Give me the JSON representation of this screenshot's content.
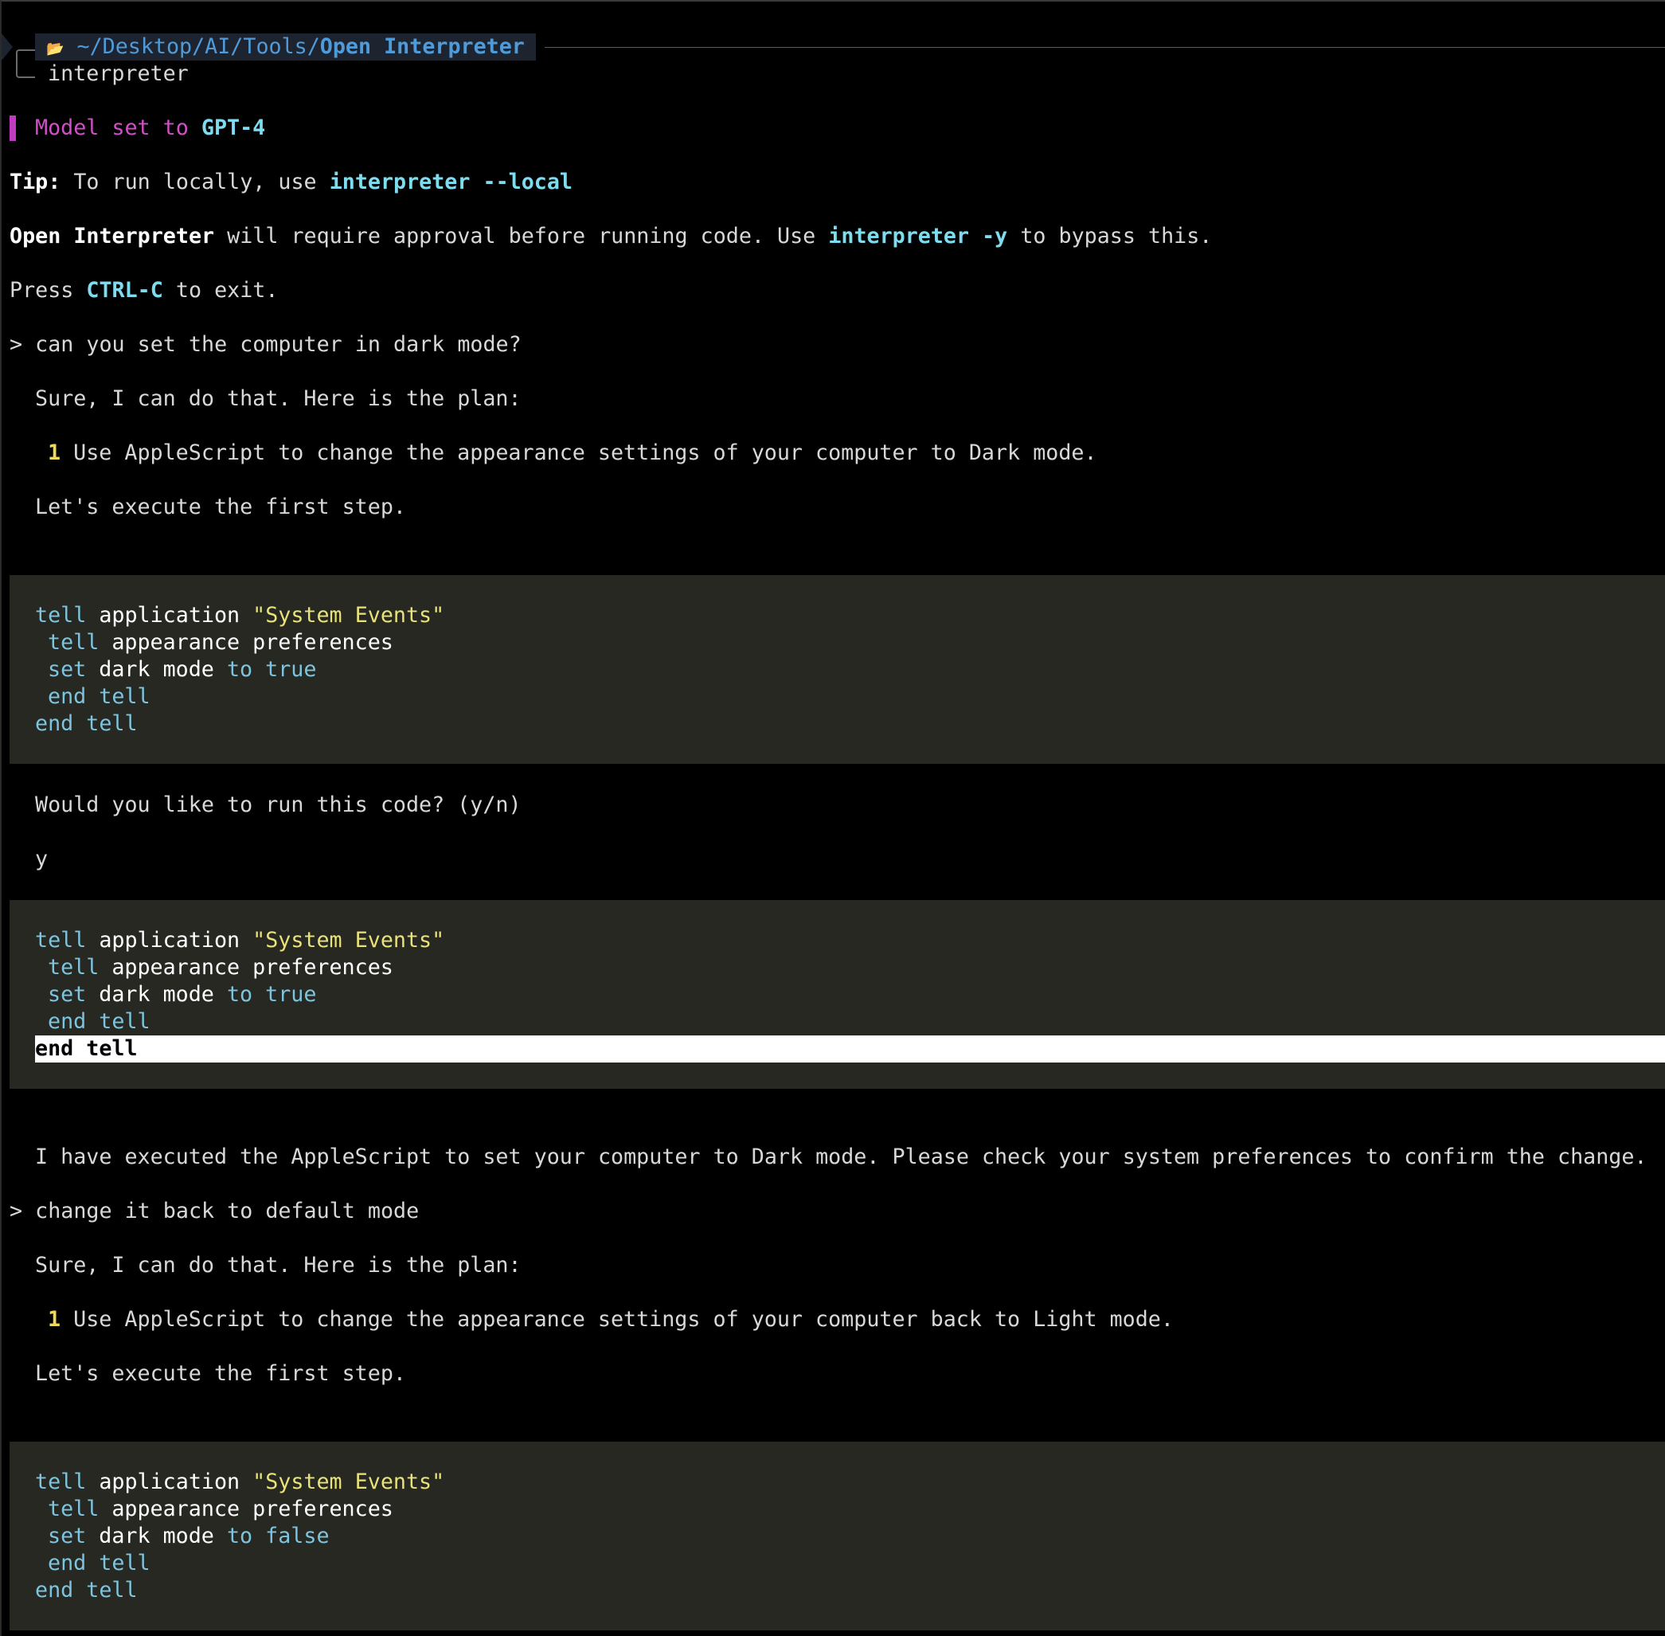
{
  "header": {
    "folder_icon": "📂",
    "path_prefix": "~/Desktop/AI/Tools/",
    "path_current": "Open Interpreter",
    "command": "interpreter"
  },
  "model_line": {
    "text": "Model set to ",
    "model": "GPT-4"
  },
  "tip": {
    "label": "Tip:",
    "text": " To run locally, use ",
    "command": "interpreter --local"
  },
  "approval": {
    "app": "Open Interpreter",
    "text1": " will require approval before running code. Use ",
    "command": "interpreter -y",
    "text2": " to bypass this."
  },
  "exit_line": {
    "text1": "Press ",
    "key": "CTRL-C",
    "text2": " to exit."
  },
  "conversation": {
    "prompt1": "> can you set the computer in dark mode?",
    "reply1_intro": "Sure, I can do that. Here is the plan:",
    "reply1_step_num": "1",
    "reply1_step": " Use AppleScript to change the appearance settings of your computer to Dark mode.",
    "reply1_exec": "Let's execute the first step.",
    "confirm_question": "Would you like to run this code? (y/n)",
    "confirm_answer": "y",
    "result": "I have executed the AppleScript to set your computer to Dark mode. Please check your system preferences to confirm the change.",
    "prompt2": "> change it back to default mode",
    "reply2_intro": "Sure, I can do that. Here is the plan:",
    "reply2_step_num": "1",
    "reply2_step": " Use AppleScript to change the appearance settings of your computer back to Light mode.",
    "reply2_exec": "Let's execute the first step."
  },
  "code": {
    "tell": "tell",
    "application": " application ",
    "system_events": "\"System Events\"",
    "appearance": " appearance preferences",
    "set": "set",
    "dark_mode": " dark mode ",
    "to": "to",
    "true": "true",
    "false": "false",
    "end": "end",
    "end_tell_line": "end tell"
  },
  "colors": {
    "background": "#000000",
    "code_background": "#272822",
    "keyword": "#7cc4df",
    "string": "#e9e27a",
    "accent_magenta": "#d14fc7",
    "command_cyan": "#7fdcef",
    "path_blue": "#4f9bd9"
  }
}
